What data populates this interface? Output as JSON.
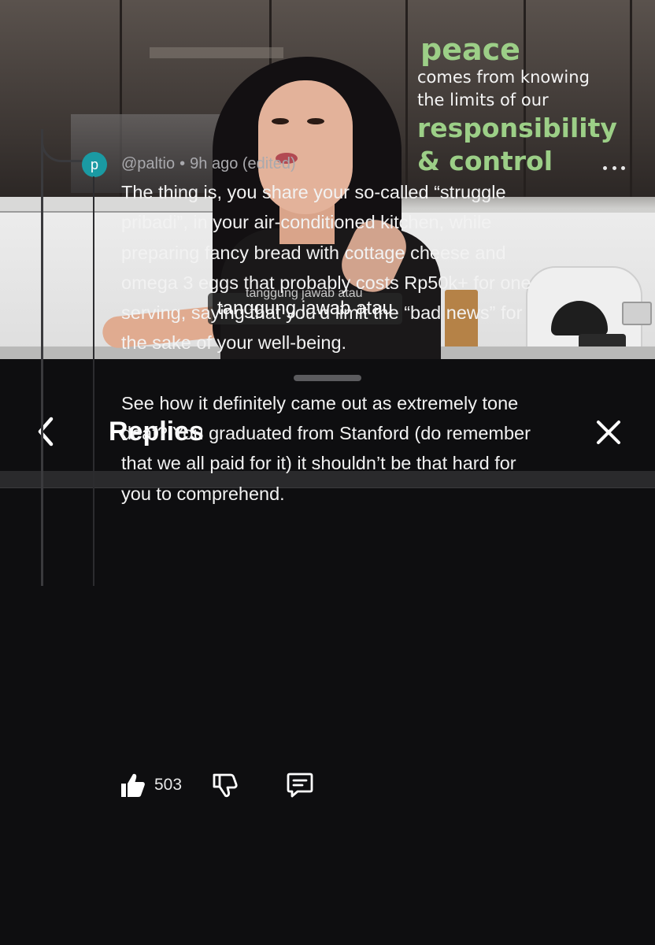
{
  "video": {
    "quote": {
      "word1": "peace",
      "line1": "comes from knowing",
      "line2": "the limits of our",
      "word2": "responsibility",
      "word3": "& control"
    },
    "subtitle": "tanggung jawab atau",
    "subtitle_ghost": "tanggung jawab atau",
    "colors": {
      "quote_accent": "#9ccf87"
    }
  },
  "panel": {
    "title": "Replies",
    "back_icon": "chevron-left-icon",
    "close_icon": "close-icon"
  },
  "comment": {
    "avatar_letter": "p",
    "avatar_color": "#1a9aa3",
    "author": "@paltio",
    "separator": "•",
    "time": "9h ago (edited)",
    "paragraph1": "The thing is, you share your so-called “struggle\npribadi”, in your air-conditioned kitchen, while\npreparing fancy bread with cottage cheese and\nomega 3 eggs that probably costs Rp50k+ for one\nserving, saying that you’d limit the “bad news” for\nthe sake of your well-being.",
    "paragraph2": "See how it definitely came out as extremely tone\ndeaf? You graduated from Stanford (do remember\nthat we all paid for it) it shouldn’t be that hard for\nyou to comprehend.",
    "likes": "503",
    "icons": [
      "thumbs-up-icon",
      "thumbs-down-icon",
      "reply-icon",
      "more-icon"
    ]
  }
}
